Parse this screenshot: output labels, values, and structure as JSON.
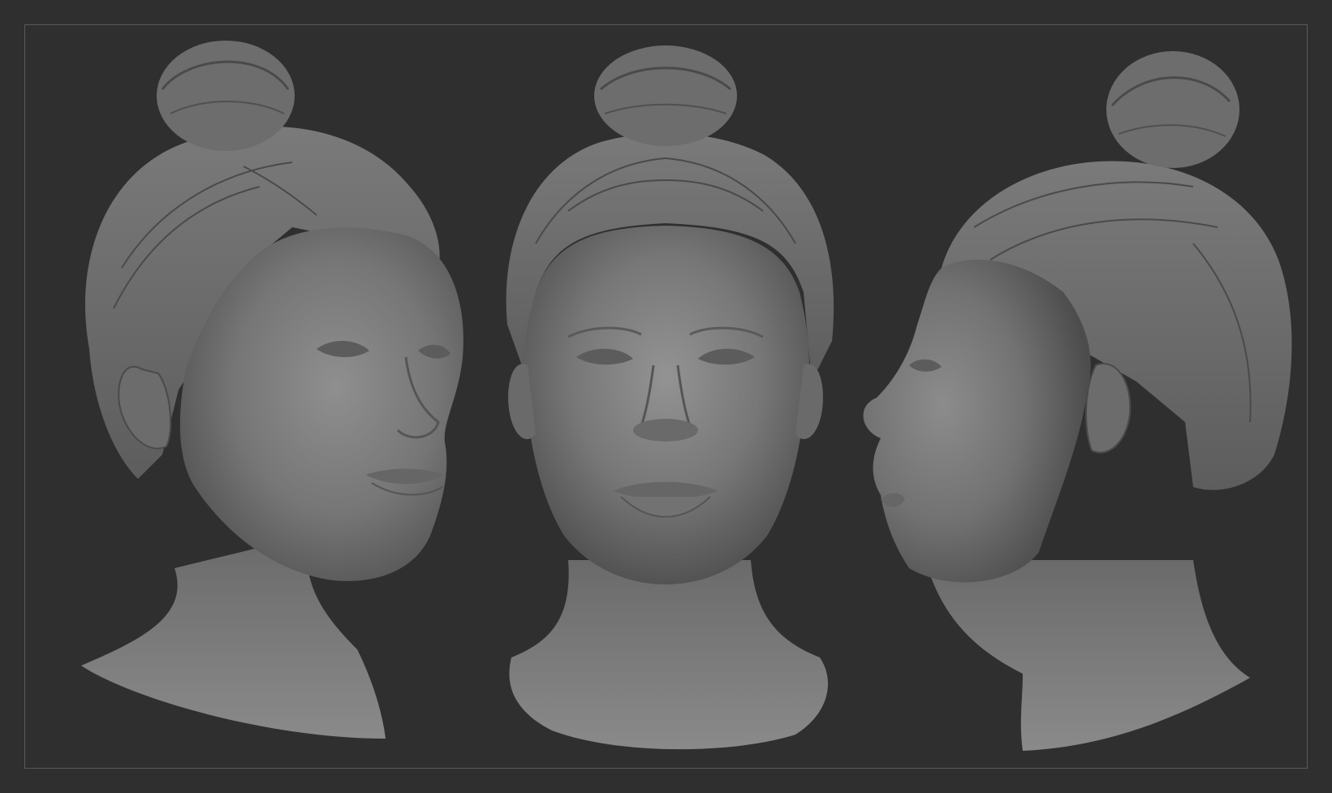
{
  "canvas": {
    "background_color": "#2f2f2f",
    "frame_border_color": "#5a5a5a",
    "clay_color": "#7b7b7b",
    "clay_shadow_color": "#4e4e4e",
    "clay_highlight_color": "#9a9a9a"
  },
  "views": [
    {
      "name": "three-quarter-view",
      "icon": "sculpt-head-3q"
    },
    {
      "name": "front-view",
      "icon": "sculpt-head-front"
    },
    {
      "name": "profile-view",
      "icon": "sculpt-head-profile"
    }
  ]
}
